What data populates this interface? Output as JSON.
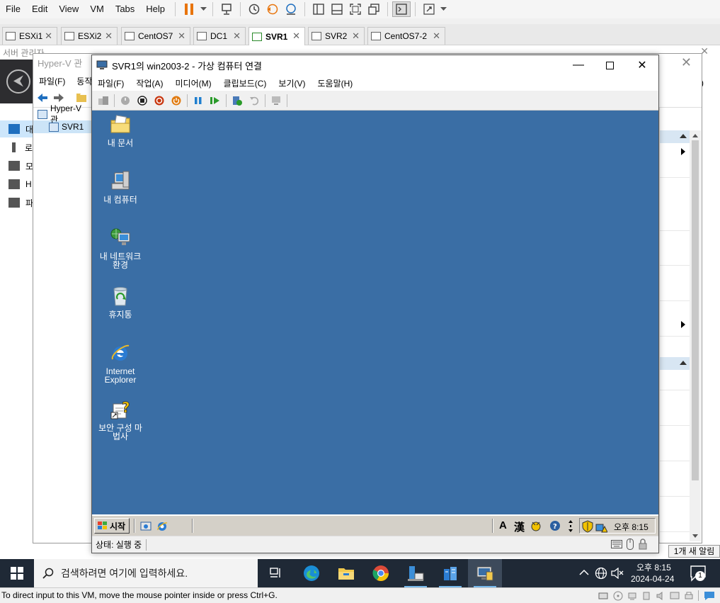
{
  "vmware": {
    "menu": [
      "File",
      "Edit",
      "View",
      "VM",
      "Tabs",
      "Help"
    ],
    "tabs": [
      {
        "label": "ESXi1",
        "active": false
      },
      {
        "label": "ESXi2",
        "active": false
      },
      {
        "label": "CentOS7",
        "active": false
      },
      {
        "label": "DC1",
        "active": false
      },
      {
        "label": "SVR1",
        "active": true
      },
      {
        "label": "SVR2",
        "active": false
      },
      {
        "label": "CentOS7-2",
        "active": false
      }
    ],
    "status_text": "To direct input to this VM, move the mouse pointer inside or press Ctrl+G."
  },
  "server_manager": {
    "title": "서버 관리자",
    "nav": [
      "대",
      "로",
      "모",
      "H",
      "파"
    ]
  },
  "hyperv": {
    "title": "Hyper-V 관",
    "menu": [
      "파일(F)",
      "동작"
    ],
    "tree": [
      "Hyper-V 관",
      "SVR1"
    ],
    "right_fragment": ")",
    "notification": "1개 새 알림"
  },
  "vm_connection": {
    "title": "SVR1의 win2003-2 - 가상 컴퓨터 연결",
    "menu": [
      "파일(F)",
      "작업(A)",
      "미디어(M)",
      "클립보드(C)",
      "보기(V)",
      "도움말(H)"
    ],
    "status": "상태: 실행 중",
    "guest": {
      "desktop_icons": [
        {
          "label": "내 문서",
          "icon": "my-documents-icon"
        },
        {
          "label": "내 컴퓨터",
          "icon": "my-computer-icon"
        },
        {
          "label": "내 네트워크 환경",
          "icon": "network-places-icon"
        },
        {
          "label": "휴지통",
          "icon": "recycle-bin-icon"
        },
        {
          "label": "Internet Explorer",
          "icon": "ie-icon"
        },
        {
          "label": "보안 구성 마법사",
          "icon": "security-wizard-icon"
        }
      ],
      "start_label": "시작",
      "ime_a": "A",
      "ime_han": "漢",
      "clock": "오후 8:15"
    }
  },
  "windows_taskbar": {
    "search_placeholder": "검색하려면 여기에 입력하세요.",
    "time": "오후 8:15",
    "date": "2024-04-24",
    "notification_count": "1"
  },
  "colors": {
    "guest_desktop": "#3a6ea5",
    "guest_taskbar": "#d4d0c8",
    "win_taskbar": "#1f2936",
    "vmware_pause": "#e8740c"
  }
}
